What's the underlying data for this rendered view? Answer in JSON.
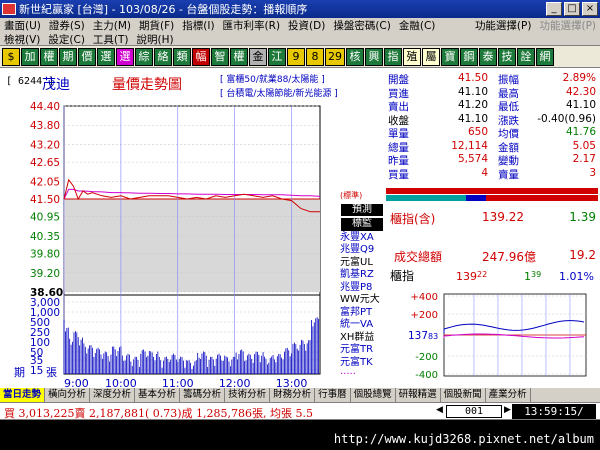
{
  "window": {
    "title": "新世紀贏家 [台灣] - 103/08/26 - 台盤個股走勢：播報順序",
    "minimize": "_",
    "maximize": "□",
    "close": "×"
  },
  "menu": {
    "row1": [
      "畫面(U)",
      "證券(S)",
      "主力(M)",
      "期貨(F)",
      "指標(I)",
      "匯市利率(R)",
      "投資(D)",
      "操盤密碼(C)",
      "金融(C)",
      "功能選擇(P)",
      "功能選擇(P)"
    ],
    "row2": [
      "檢視(V)",
      "設定(C)",
      "工具(T)",
      "說明(H)"
    ]
  },
  "toolbar": {
    "buttons": [
      "$",
      "加",
      "權",
      "期",
      "價",
      "選",
      "選",
      "綜",
      "絡",
      "類",
      "幅",
      "智",
      "權",
      "金",
      "江",
      "9",
      "8",
      "29",
      "核",
      "興",
      "指",
      "殖",
      "屬",
      "寶",
      "鋼",
      "泰",
      "技",
      "詮",
      "網"
    ],
    "styles": [
      "y",
      "g",
      "g",
      "g",
      "g",
      "g",
      "sel",
      "g",
      "g",
      "g",
      "r",
      "g",
      "g",
      "gray",
      "g",
      "y",
      "y",
      "y",
      "g",
      "g",
      "g",
      "pale",
      "pale",
      "g",
      "g",
      "g",
      "g",
      "g",
      "g"
    ]
  },
  "stock": {
    "code": "[ 6244 ]",
    "name": "茂迪",
    "chart_title": "量價走勢圖",
    "tag1": "[ 富櫃50/就業88/太陽能 ]",
    "tag2": "[ 台積電/太陽節能/新光能源 ]"
  },
  "chart_data": {
    "type": "line",
    "price_ticks": [
      "44.40",
      "43.80",
      "43.20",
      "42.65",
      "42.05",
      "41.50",
      "40.95",
      "40.35",
      "39.80",
      "39.20",
      "38.60"
    ],
    "vol_ticks": [
      "3,000",
      "1,000",
      "500",
      "250",
      "100",
      "50",
      "35",
      "15"
    ],
    "vol_label": "張",
    "x_labels": [
      "9:00",
      "10:00",
      "11:00",
      "12:00",
      "13:00"
    ],
    "x": [
      0,
      5,
      10,
      15,
      20,
      25,
      30,
      40,
      50,
      60,
      70,
      80,
      90,
      100,
      110,
      120,
      130,
      140,
      150,
      160,
      170,
      180,
      190,
      200,
      210,
      220,
      230,
      240,
      250,
      260,
      270
    ],
    "price": [
      41.5,
      42.1,
      41.9,
      41.5,
      41.75,
      41.65,
      41.7,
      41.6,
      41.55,
      41.6,
      41.5,
      41.55,
      41.6,
      41.6,
      41.6,
      41.55,
      41.5,
      41.55,
      41.5,
      41.6,
      41.55,
      41.6,
      41.65,
      41.6,
      41.55,
      41.6,
      41.5,
      41.45,
      41.2,
      41.1,
      41.1
    ],
    "avg": [
      41.5,
      41.8,
      41.8,
      41.75,
      41.75,
      41.74,
      41.73,
      41.72,
      41.7,
      41.7,
      41.69,
      41.68,
      41.68,
      41.67,
      41.67,
      41.66,
      41.66,
      41.65,
      41.65,
      41.65,
      41.64,
      41.64,
      41.64,
      41.64,
      41.63,
      41.63,
      41.63,
      41.62,
      41.6,
      41.6,
      41.58
    ],
    "volume": [
      1800,
      400,
      200,
      300,
      180,
      120,
      100,
      80,
      60,
      90,
      50,
      40,
      70,
      60,
      40,
      50,
      40,
      30,
      60,
      40,
      50,
      40,
      70,
      50,
      60,
      40,
      50,
      80,
      120,
      150,
      900
    ],
    "ref_price": 41.5,
    "ylim": [
      38.6,
      44.4
    ],
    "period_label": "期"
  },
  "legend": {
    "note": "(標準)",
    "box1": "預測",
    "box2": "標監",
    "items": [
      {
        "text": "永豐XA",
        "color": "#0000c0"
      },
      {
        "text": "兆豐Q9",
        "color": "#0000c0"
      },
      {
        "text": "元富UL",
        "color": "#000000"
      },
      {
        "text": "凱基RZ",
        "color": "#0000c0"
      },
      {
        "text": "兆豐P8",
        "color": "#0000c0"
      },
      {
        "text": "WW元大",
        "color": "#000000"
      },
      {
        "text": "富邦PT",
        "color": "#0000c0"
      },
      {
        "text": "統一VA",
        "color": "#0000c0"
      },
      {
        "text": "XH群益",
        "color": "#000000"
      },
      {
        "text": "元富TR",
        "color": "#0000c0"
      },
      {
        "text": "元富TK",
        "color": "#0000c0"
      },
      {
        "text": "·····",
        "color": "#d000d0"
      }
    ]
  },
  "quote": [
    {
      "l1": "開盤",
      "v1": "41.50",
      "c1": "red",
      "l2": "振幅",
      "v2": "2.89%",
      "c2": "red"
    },
    {
      "l1": "買進",
      "v1": "41.10",
      "c1": "blk",
      "l2": "最高",
      "v2": "42.30",
      "c2": "red"
    },
    {
      "l1": "賣出",
      "v1": "41.20",
      "c1": "blk",
      "l2": "最低",
      "v2": "41.10",
      "c2": "blk"
    },
    {
      "l1": "收盤",
      "v1": "41.10",
      "c1": "blk",
      "l2": "漲跌",
      "v2": "-0.40(0.96)",
      "c2": "blk"
    },
    {
      "l1": "單量",
      "v1": "650",
      "c1": "red",
      "l2": "均價",
      "v2": "41.76",
      "c2": "green"
    },
    {
      "l1": "總量",
      "v1": "12,114",
      "c1": "red",
      "l2": "金額",
      "v2": "5.05",
      "c2": "red"
    },
    {
      "l1": "昨量",
      "v1": "5,574",
      "c1": "red",
      "l2": "變動",
      "v2": "2.17",
      "c2": "red"
    },
    {
      "l1": "買量",
      "v1": "4",
      "c1": "red",
      "l2": "賣量",
      "v2": "3",
      "c2": "red"
    }
  ],
  "index": {
    "label": "櫃指(含)",
    "value": "139.22",
    "change": "1.39",
    "total_label": "成交總額",
    "total_value": "247.96億",
    "total_change": "19.2",
    "mini_label": "櫃指",
    "mini_value": "139",
    "mini_value_sup": "22",
    "mini_change": "1",
    "mini_change_sup": "39",
    "mini_pct": "1.01%",
    "mini_base": "137",
    "mini_base_sup": "83",
    "ticks": [
      "+400",
      "+200",
      "-200",
      "-400"
    ]
  },
  "tabs": [
    "當日走勢",
    "橫向分析",
    "深度分析",
    "基本分析",
    "籌碼分析",
    "技術分析",
    "財務分析",
    "行事曆",
    "個股總覽",
    "研報精選",
    "個股新聞",
    "產業分析"
  ],
  "ticker": {
    "summary": "買 3,013,225賣 2,187,881( 0.73)成 1,285,786張, 均張 5.5",
    "pager": "001",
    "clock": "13:59:15/"
  },
  "footer": {
    "url": "http://www.kujd3268.pixnet.net/album"
  }
}
